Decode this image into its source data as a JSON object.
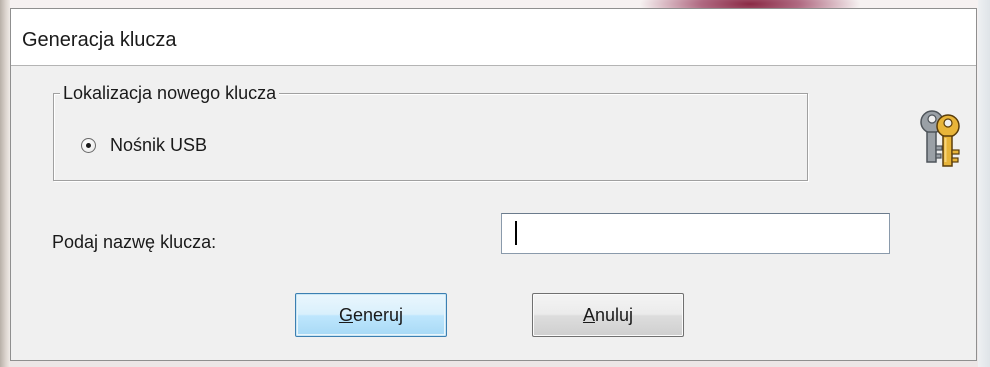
{
  "window": {
    "title": "Generacja klucza"
  },
  "location_group": {
    "legend": "Lokalizacja nowego klucza",
    "option_label": "Nośnik USB",
    "option_selected": true
  },
  "key_name": {
    "label": "Podaj nazwę klucza:",
    "value": ""
  },
  "buttons": {
    "generate": {
      "mnemonic": "G",
      "rest": "eneruj"
    },
    "cancel": {
      "mnemonic": "A",
      "rest": "nuluj"
    }
  },
  "icons": {
    "dialog_icon": "keys-icon"
  },
  "colors": {
    "dialog_bg": "#f0f0f0",
    "titlebar_bg": "#ffffff",
    "key_gold": "#e0a92a",
    "key_gray": "#8a9098"
  }
}
